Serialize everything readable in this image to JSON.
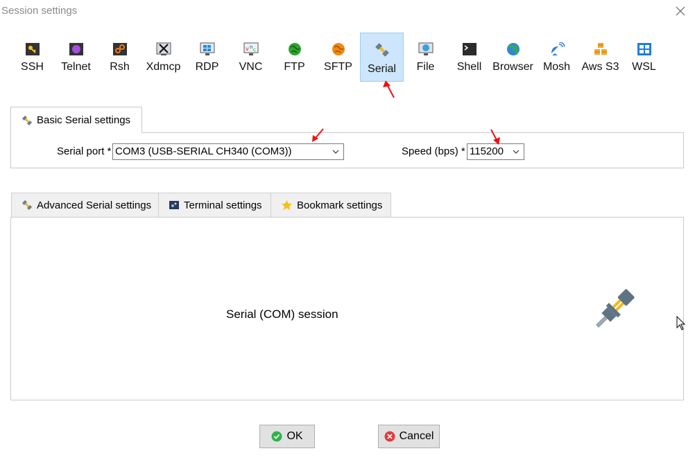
{
  "window": {
    "title": "Session settings"
  },
  "session_types": [
    {
      "label": "SSH",
      "icon": "key-icon"
    },
    {
      "label": "Telnet",
      "icon": "telnet-icon"
    },
    {
      "label": "Rsh",
      "icon": "rsh-icon"
    },
    {
      "label": "Xdmcp",
      "icon": "xdmcp-icon"
    },
    {
      "label": "RDP",
      "icon": "rdp-icon"
    },
    {
      "label": "VNC",
      "icon": "vnc-icon"
    },
    {
      "label": "FTP",
      "icon": "ftp-globe-icon"
    },
    {
      "label": "SFTP",
      "icon": "sftp-globe-icon"
    },
    {
      "label": "Serial",
      "icon": "plug-icon",
      "selected": true
    },
    {
      "label": "File",
      "icon": "file-monitor-icon"
    },
    {
      "label": "Shell",
      "icon": "terminal-icon"
    },
    {
      "label": "Browser",
      "icon": "globe-icon"
    },
    {
      "label": "Mosh",
      "icon": "satellite-icon"
    },
    {
      "label": "Aws S3",
      "icon": "aws-cubes-icon"
    },
    {
      "label": "WSL",
      "icon": "windows-icon"
    }
  ],
  "basic_tab": {
    "label": "Basic Serial settings"
  },
  "serial_port": {
    "label": "Serial port *",
    "value": "COM3  (USB-SERIAL CH340 (COM3))"
  },
  "speed": {
    "label": "Speed (bps) *",
    "value": "115200"
  },
  "lower_tabs": [
    {
      "label": "Advanced Serial settings"
    },
    {
      "label": "Terminal settings"
    },
    {
      "label": "Bookmark settings"
    }
  ],
  "panel": {
    "label": "Serial (COM) session"
  },
  "buttons": {
    "ok": "OK",
    "cancel": "Cancel"
  },
  "colors": {
    "selected_bg": "#cde6fb",
    "annotation_red": "#ee1111",
    "ok_green": "#2fb34a",
    "cancel_red": "#e23b3b"
  }
}
